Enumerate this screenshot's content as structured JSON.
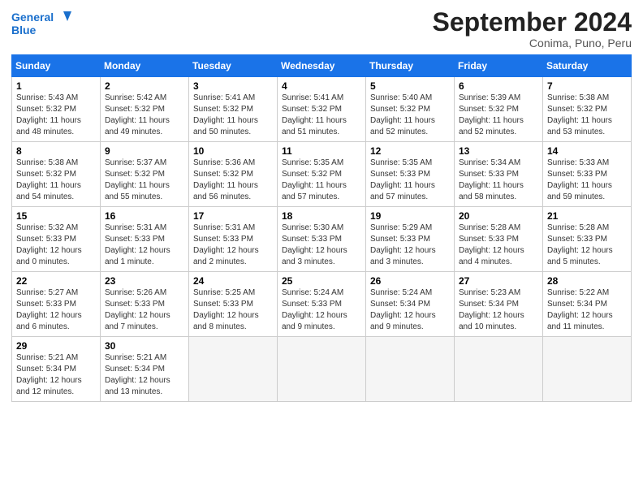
{
  "logo": {
    "line1": "General",
    "line2": "Blue"
  },
  "title": "September 2024",
  "subtitle": "Conima, Puno, Peru",
  "weekdays": [
    "Sunday",
    "Monday",
    "Tuesday",
    "Wednesday",
    "Thursday",
    "Friday",
    "Saturday"
  ],
  "weeks": [
    [
      {
        "day": "1",
        "sunrise": "5:43 AM",
        "sunset": "5:32 PM",
        "daylight": "11 hours and 48 minutes."
      },
      {
        "day": "2",
        "sunrise": "5:42 AM",
        "sunset": "5:32 PM",
        "daylight": "11 hours and 49 minutes."
      },
      {
        "day": "3",
        "sunrise": "5:41 AM",
        "sunset": "5:32 PM",
        "daylight": "11 hours and 50 minutes."
      },
      {
        "day": "4",
        "sunrise": "5:41 AM",
        "sunset": "5:32 PM",
        "daylight": "11 hours and 51 minutes."
      },
      {
        "day": "5",
        "sunrise": "5:40 AM",
        "sunset": "5:32 PM",
        "daylight": "11 hours and 52 minutes."
      },
      {
        "day": "6",
        "sunrise": "5:39 AM",
        "sunset": "5:32 PM",
        "daylight": "11 hours and 52 minutes."
      },
      {
        "day": "7",
        "sunrise": "5:38 AM",
        "sunset": "5:32 PM",
        "daylight": "11 hours and 53 minutes."
      }
    ],
    [
      {
        "day": "8",
        "sunrise": "5:38 AM",
        "sunset": "5:32 PM",
        "daylight": "11 hours and 54 minutes."
      },
      {
        "day": "9",
        "sunrise": "5:37 AM",
        "sunset": "5:32 PM",
        "daylight": "11 hours and 55 minutes."
      },
      {
        "day": "10",
        "sunrise": "5:36 AM",
        "sunset": "5:32 PM",
        "daylight": "11 hours and 56 minutes."
      },
      {
        "day": "11",
        "sunrise": "5:35 AM",
        "sunset": "5:32 PM",
        "daylight": "11 hours and 57 minutes."
      },
      {
        "day": "12",
        "sunrise": "5:35 AM",
        "sunset": "5:33 PM",
        "daylight": "11 hours and 57 minutes."
      },
      {
        "day": "13",
        "sunrise": "5:34 AM",
        "sunset": "5:33 PM",
        "daylight": "11 hours and 58 minutes."
      },
      {
        "day": "14",
        "sunrise": "5:33 AM",
        "sunset": "5:33 PM",
        "daylight": "11 hours and 59 minutes."
      }
    ],
    [
      {
        "day": "15",
        "sunrise": "5:32 AM",
        "sunset": "5:33 PM",
        "daylight": "12 hours and 0 minutes."
      },
      {
        "day": "16",
        "sunrise": "5:31 AM",
        "sunset": "5:33 PM",
        "daylight": "12 hours and 1 minute."
      },
      {
        "day": "17",
        "sunrise": "5:31 AM",
        "sunset": "5:33 PM",
        "daylight": "12 hours and 2 minutes."
      },
      {
        "day": "18",
        "sunrise": "5:30 AM",
        "sunset": "5:33 PM",
        "daylight": "12 hours and 3 minutes."
      },
      {
        "day": "19",
        "sunrise": "5:29 AM",
        "sunset": "5:33 PM",
        "daylight": "12 hours and 3 minutes."
      },
      {
        "day": "20",
        "sunrise": "5:28 AM",
        "sunset": "5:33 PM",
        "daylight": "12 hours and 4 minutes."
      },
      {
        "day": "21",
        "sunrise": "5:28 AM",
        "sunset": "5:33 PM",
        "daylight": "12 hours and 5 minutes."
      }
    ],
    [
      {
        "day": "22",
        "sunrise": "5:27 AM",
        "sunset": "5:33 PM",
        "daylight": "12 hours and 6 minutes."
      },
      {
        "day": "23",
        "sunrise": "5:26 AM",
        "sunset": "5:33 PM",
        "daylight": "12 hours and 7 minutes."
      },
      {
        "day": "24",
        "sunrise": "5:25 AM",
        "sunset": "5:33 PM",
        "daylight": "12 hours and 8 minutes."
      },
      {
        "day": "25",
        "sunrise": "5:24 AM",
        "sunset": "5:33 PM",
        "daylight": "12 hours and 9 minutes."
      },
      {
        "day": "26",
        "sunrise": "5:24 AM",
        "sunset": "5:34 PM",
        "daylight": "12 hours and 9 minutes."
      },
      {
        "day": "27",
        "sunrise": "5:23 AM",
        "sunset": "5:34 PM",
        "daylight": "12 hours and 10 minutes."
      },
      {
        "day": "28",
        "sunrise": "5:22 AM",
        "sunset": "5:34 PM",
        "daylight": "12 hours and 11 minutes."
      }
    ],
    [
      {
        "day": "29",
        "sunrise": "5:21 AM",
        "sunset": "5:34 PM",
        "daylight": "12 hours and 12 minutes."
      },
      {
        "day": "30",
        "sunrise": "5:21 AM",
        "sunset": "5:34 PM",
        "daylight": "12 hours and 13 minutes."
      },
      null,
      null,
      null,
      null,
      null
    ]
  ]
}
